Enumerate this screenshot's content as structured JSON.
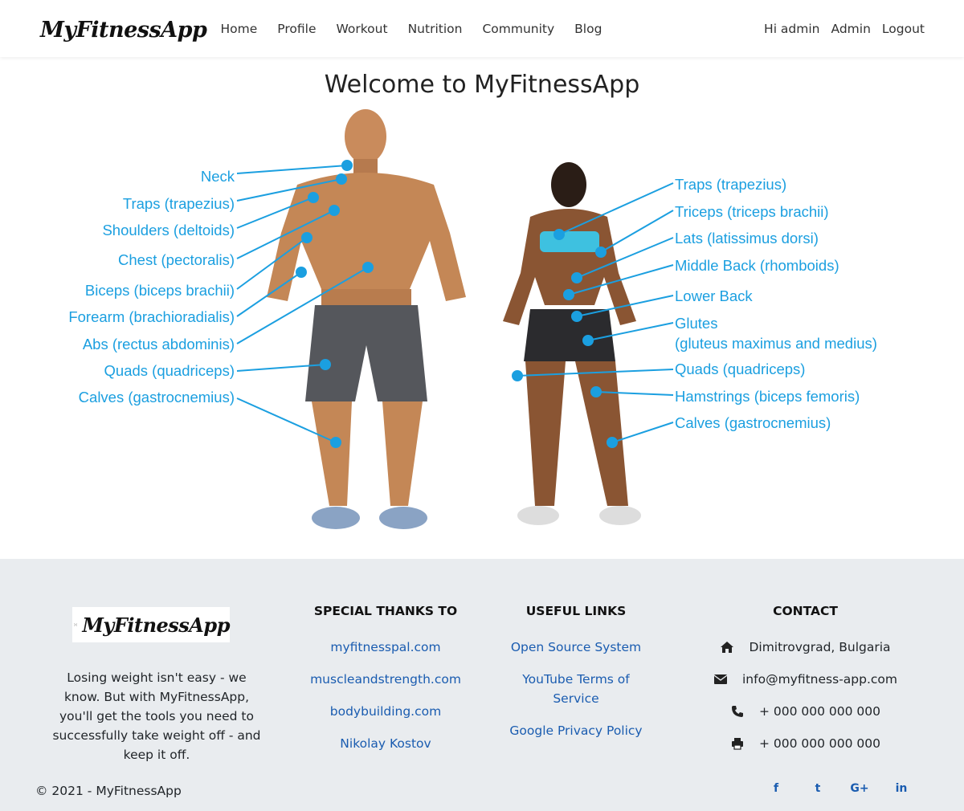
{
  "app": {
    "brand": "MyFitnessApp"
  },
  "nav": {
    "links": [
      "Home",
      "Profile",
      "Workout",
      "Nutrition",
      "Community",
      "Blog"
    ],
    "greeting": "Hi admin",
    "admin": "Admin",
    "logout": "Logout"
  },
  "main": {
    "title": "Welcome to MyFitnessApp",
    "male_labels": [
      "Neck",
      "Traps (trapezius)",
      "Shoulders (deltoids)",
      "Chest (pectoralis)",
      "Biceps (biceps brachii)",
      "Forearm (brachioradialis)",
      "Abs (rectus abdominis)",
      "Quads (quadriceps)",
      "Calves (gastrocnemius)"
    ],
    "female_labels": [
      "Traps (trapezius)",
      "Triceps (triceps brachii)",
      "Lats (latissimus dorsi)",
      "Middle Back (rhomboids)",
      "Lower Back",
      "Glutes",
      "(gluteus maximus and medius)",
      "Quads (quadriceps)",
      "Hamstrings (biceps femoris)",
      "Calves (gastrocnemius)"
    ],
    "label_color": "#1b9fe0"
  },
  "footer": {
    "about": "Losing weight isn't easy - we know. But with MyFitnessApp, you'll get the tools you need to successfully take weight off - and keep it off.",
    "thanks_title": "SPECIAL THANKS TO",
    "thanks": [
      "myfitnesspal.com",
      "muscleandstrength.com",
      "bodybuilding.com",
      "Nikolay Kostov"
    ],
    "links_title": "USEFUL LINKS",
    "links": [
      "Open Source System",
      "YouTube Terms of Service",
      "Google Privacy Policy"
    ],
    "contact_title": "CONTACT",
    "contact": {
      "address": "Dimitrovgrad, Bulgaria",
      "email": "info@myfitness-app.com",
      "phone": "+ 000 000 000 000",
      "fax": "+ 000 000 000 000"
    },
    "copyright": "© 2021 - MyFitnessApp",
    "social": [
      "f",
      "t",
      "G+",
      "in"
    ],
    "social_icons": [
      "facebook-icon",
      "twitter-icon",
      "google-plus-icon",
      "linkedin-icon"
    ],
    "link_color": "#1a5cb0"
  }
}
